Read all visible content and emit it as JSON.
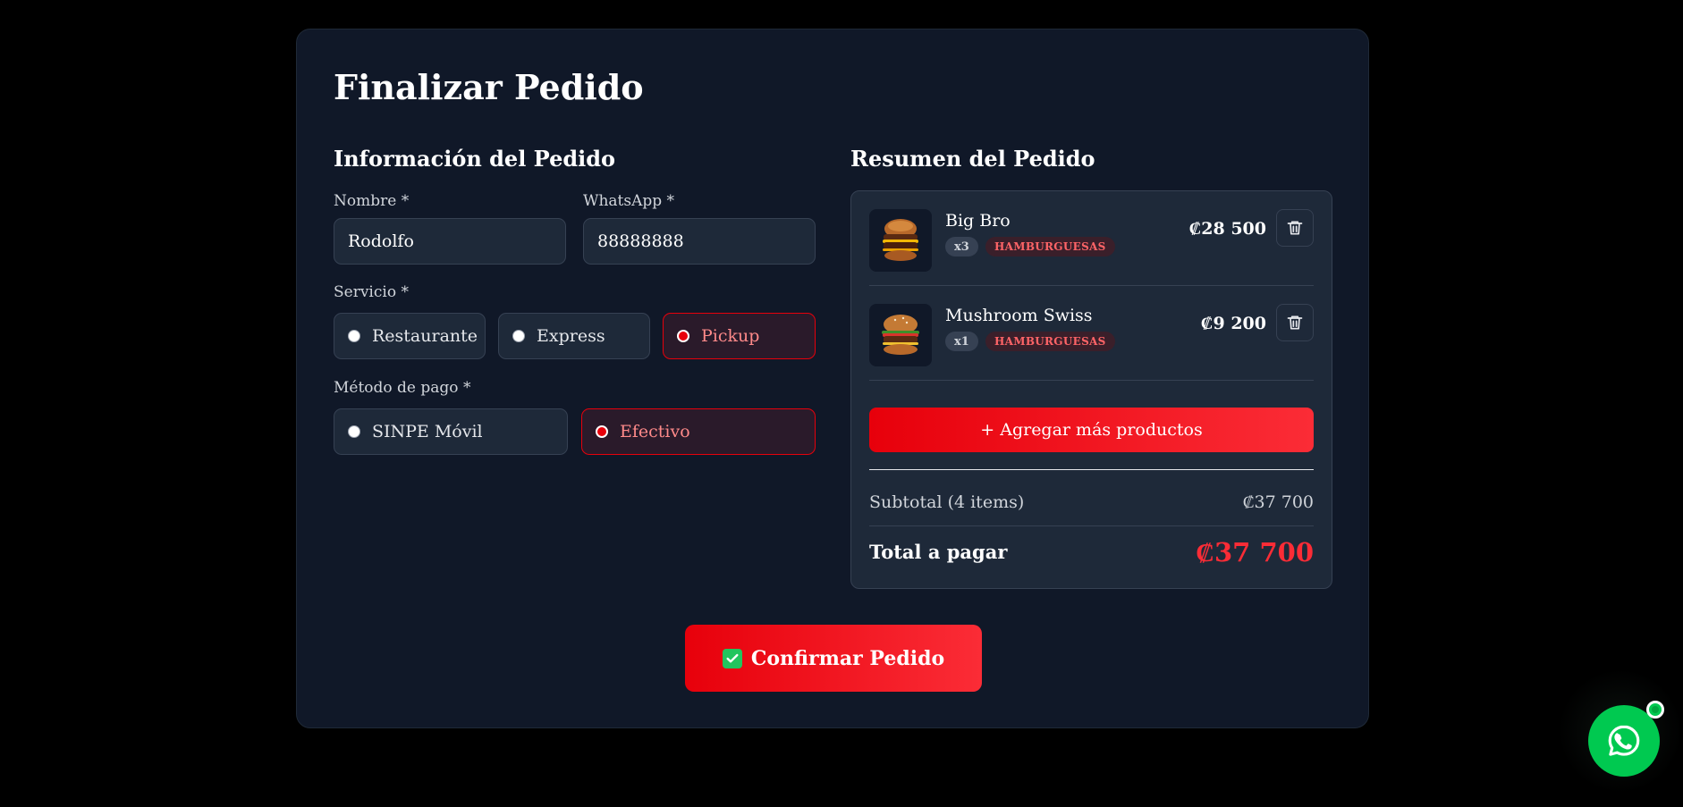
{
  "page": {
    "title": "Finalizar Pedido"
  },
  "form": {
    "section_title": "Información del Pedido",
    "name_label": "Nombre *",
    "name_value": "Rodolfo",
    "whatsapp_label": "WhatsApp *",
    "whatsapp_value": "88888888",
    "service_label": "Servicio *",
    "service_options": [
      "Restaurante",
      "Express",
      "Pickup"
    ],
    "service_selected": "Pickup",
    "payment_label": "Método de pago *",
    "payment_options": [
      "SINPE Móvil",
      "Efectivo"
    ],
    "payment_selected": "Efectivo"
  },
  "summary": {
    "section_title": "Resumen del Pedido",
    "items": [
      {
        "name": "Big Bro",
        "qty": "x3",
        "category": "HAMBURGUESAS",
        "price": "₡28 500"
      },
      {
        "name": "Mushroom Swiss",
        "qty": "x1",
        "category": "HAMBURGUESAS",
        "price": "₡9 200"
      }
    ],
    "add_more_label": "+ Agregar más productos",
    "subtotal_label": "Subtotal (4 items)",
    "subtotal_value": "₡37 700",
    "total_label": "Total a pagar",
    "total_value": "₡37 700"
  },
  "confirm": {
    "label": "Confirmar Pedido",
    "icon": "check-mark-icon"
  },
  "floating": {
    "icon": "whatsapp-icon"
  },
  "colors": {
    "accent": "#e7000b",
    "accent_light": "#fb2c36",
    "card_bg": "#101828",
    "panel_bg": "#1e2939",
    "whatsapp_green": "#00c950"
  }
}
